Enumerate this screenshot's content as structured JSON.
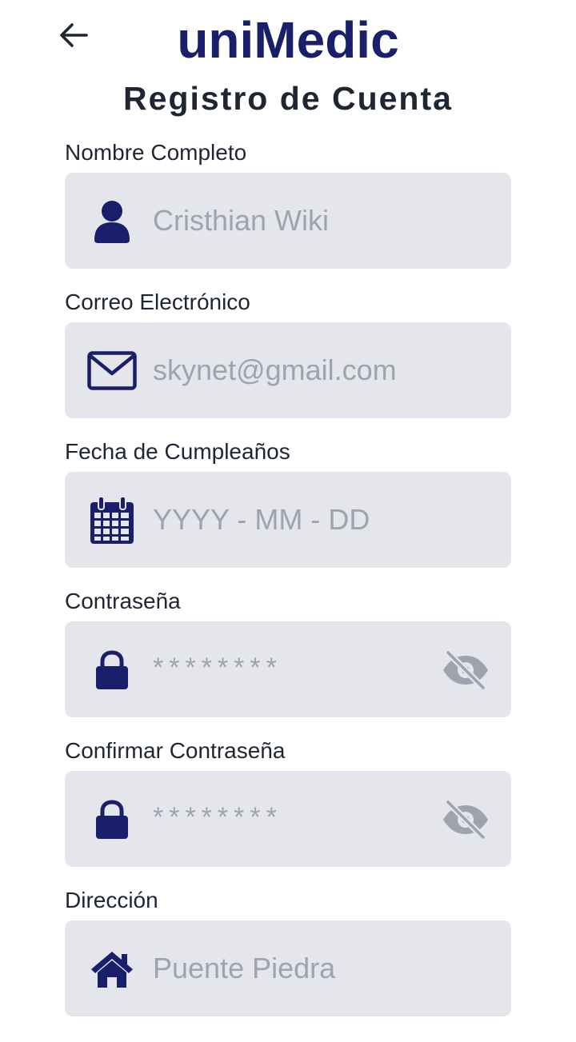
{
  "header": {
    "back_icon": "arrow-left-icon",
    "app_title": "uniMedic",
    "page_title": "Registro de Cuenta"
  },
  "colors": {
    "brand": "#1a1f6b",
    "input_bg": "#e5e6eb",
    "placeholder": "#9ea3b0",
    "label": "#1f2633"
  },
  "fields": [
    {
      "label": "Nombre Completo",
      "placeholder": "Cristhian Wiki",
      "icon": "user-icon"
    },
    {
      "label": "Correo Electrónico",
      "placeholder": "skynet@gmail.com",
      "icon": "envelope-icon"
    },
    {
      "label": "Fecha de Cumpleaños",
      "placeholder": "YYYY - MM - DD",
      "icon": "calendar-icon"
    },
    {
      "label": "Contraseña",
      "placeholder": "********",
      "icon": "lock-icon",
      "toggle_icon": "eye-slash-icon"
    },
    {
      "label": "Confirmar Contraseña",
      "placeholder": "********",
      "icon": "lock-icon",
      "toggle_icon": "eye-slash-icon"
    },
    {
      "label": "Dirección",
      "placeholder": "Puente Piedra",
      "icon": "home-icon"
    }
  ]
}
